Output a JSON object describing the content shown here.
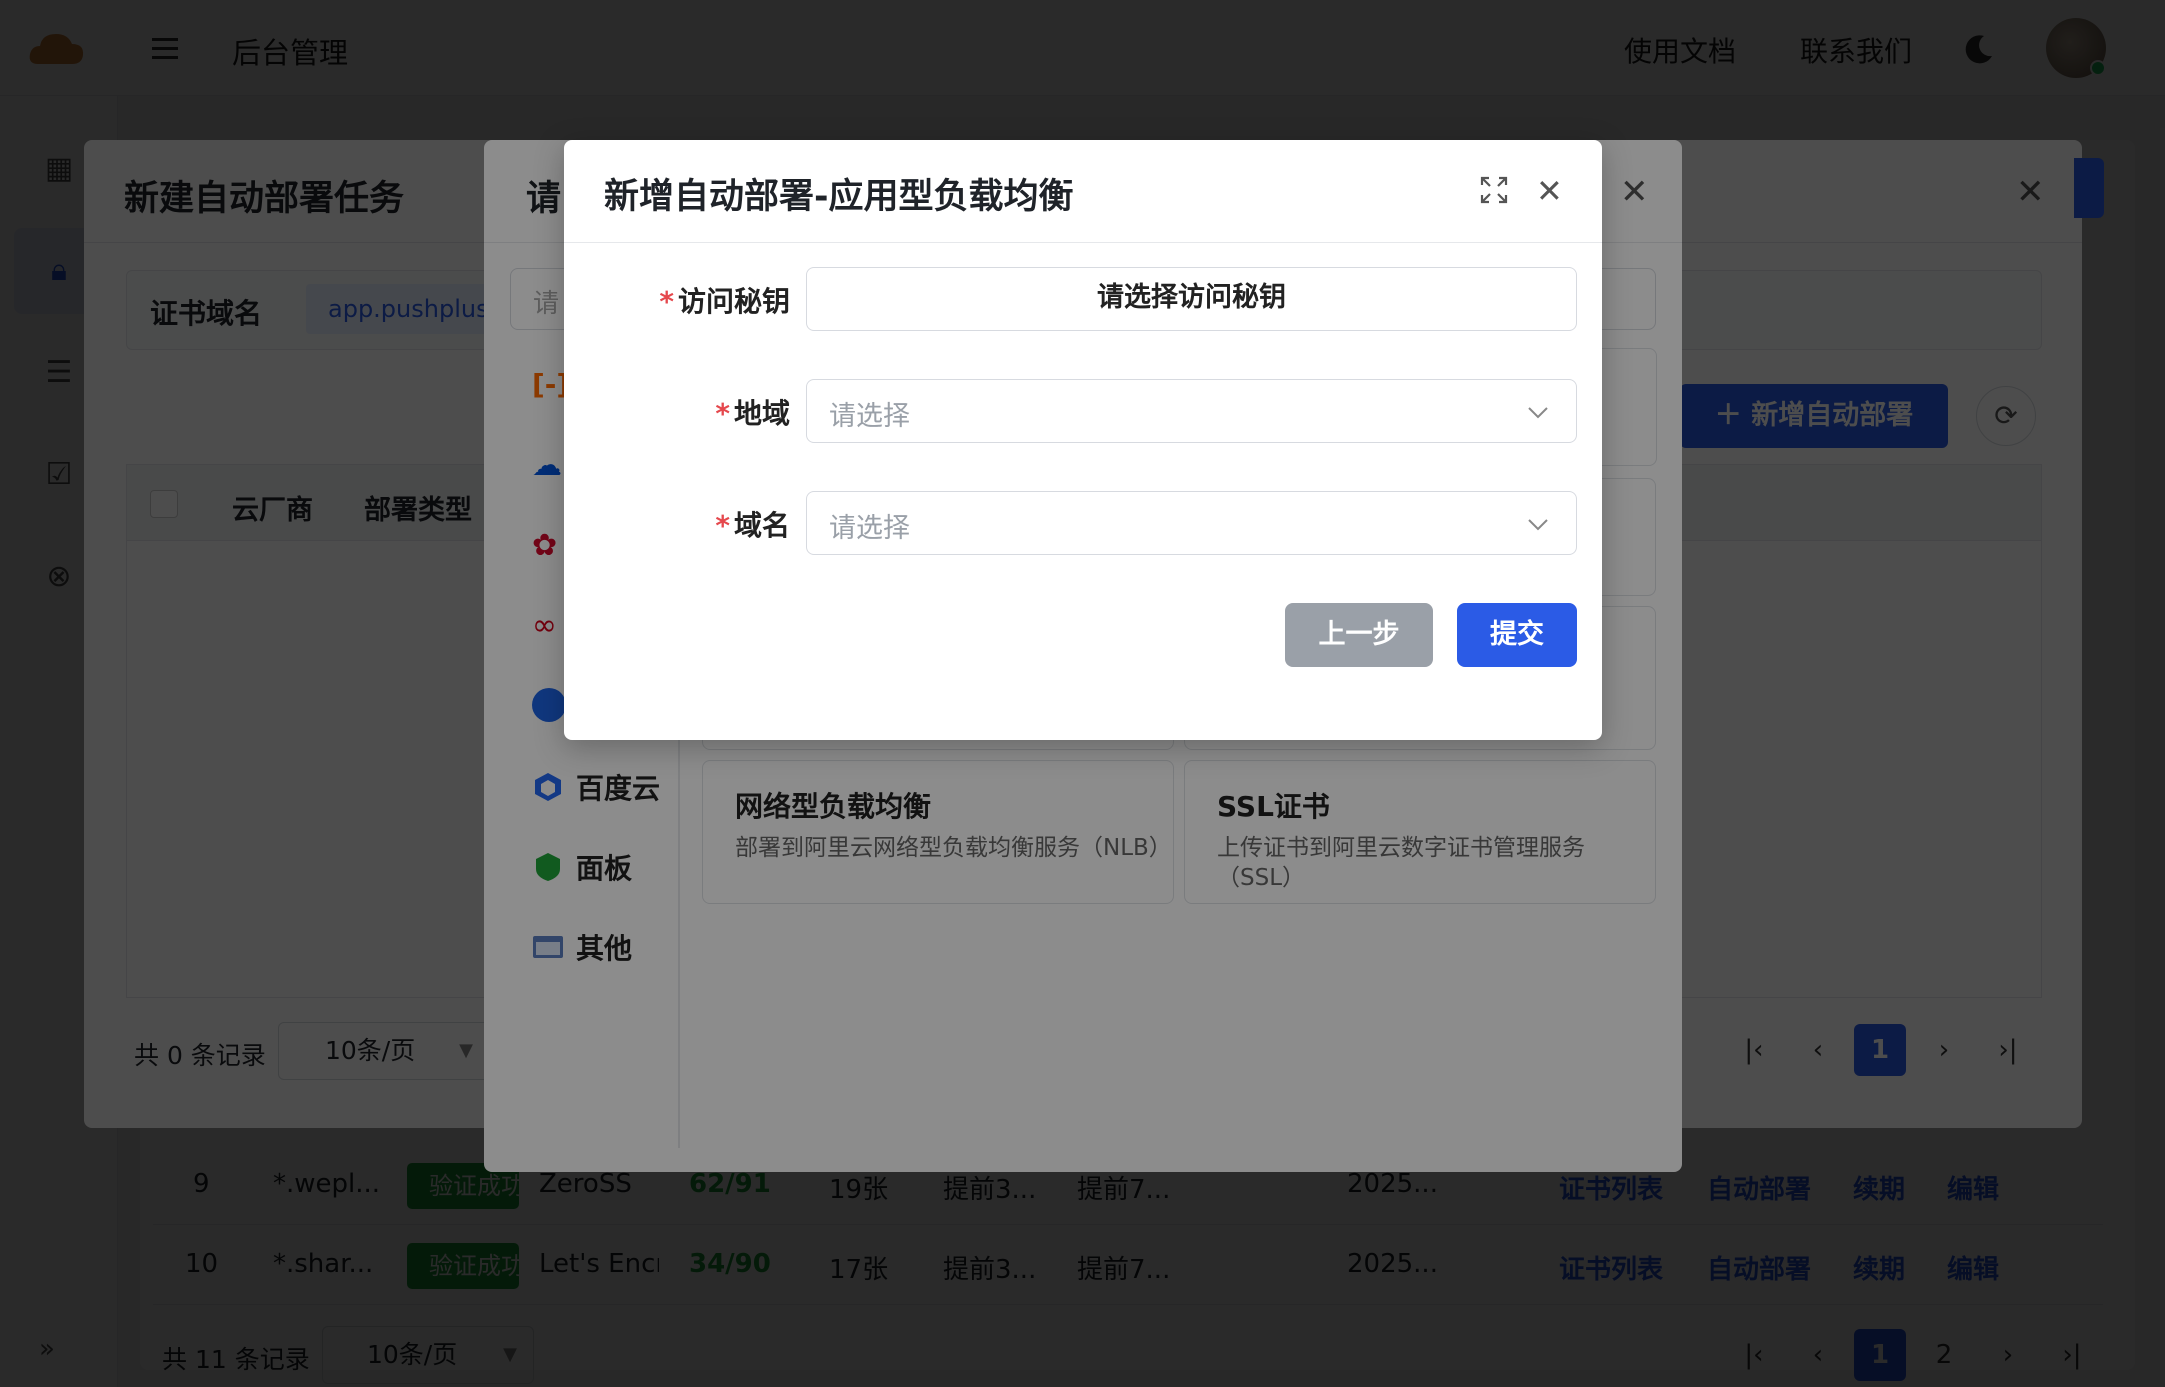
{
  "topbar": {
    "title": "后台管理",
    "docs": "使用文档",
    "contact": "联系我们"
  },
  "bg_table": {
    "rows": [
      {
        "num": "9",
        "domain": "*.wepl...",
        "status": "验证成功",
        "ca": "ZeroSS",
        "score": "62/91",
        "count": "19张",
        "a": "提前3...",
        "b": "提前7...",
        "date": "2025..."
      },
      {
        "num": "10",
        "domain": "*.shar...",
        "status": "验证成功",
        "ca": "Let's Encr",
        "score": "34/90",
        "count": "17张",
        "a": "提前3...",
        "b": "提前7...",
        "date": "2025..."
      }
    ],
    "actions": {
      "list": "证书列表",
      "deploy": "自动部署",
      "renew": "续期",
      "edit": "编辑"
    },
    "footer_count": "共 11 条记录",
    "page_size": "10条/页",
    "pages": [
      "1",
      "2"
    ]
  },
  "task_modal": {
    "title": "新建自动部署任务",
    "cert_domain_label": "证书域名",
    "cert_domain_value": "app.pushplus.p",
    "add_button": "新增自动部署",
    "columns": [
      "云厂商",
      "部署类型"
    ],
    "footer_count": "共 0 条记录",
    "page_size": "10条/页",
    "page": "1"
  },
  "provider_modal": {
    "title": "请",
    "search_placeholder": "请",
    "providers": [
      "百度云",
      "面板",
      "其他"
    ],
    "cards": [
      {
        "title": "网络型负载均衡",
        "desc": "部署到阿里云网络型负载均衡服务（NLB）"
      },
      {
        "title": "SSL证书",
        "desc": "上传证书到阿里云数字证书管理服务（SSL）"
      }
    ]
  },
  "form_modal": {
    "title": "新增自动部署-应用型负载均衡",
    "fields": [
      {
        "label": "访问秘钥",
        "placeholder": "请选择访问秘钥"
      },
      {
        "label": "地域",
        "placeholder": "请选择"
      },
      {
        "label": "域名",
        "placeholder": "请选择"
      }
    ],
    "prev_button": "上一步",
    "submit_button": "提交"
  },
  "colors": {
    "primary": "#2b5be6",
    "success": "#22a43a",
    "required": "#e5484d"
  }
}
